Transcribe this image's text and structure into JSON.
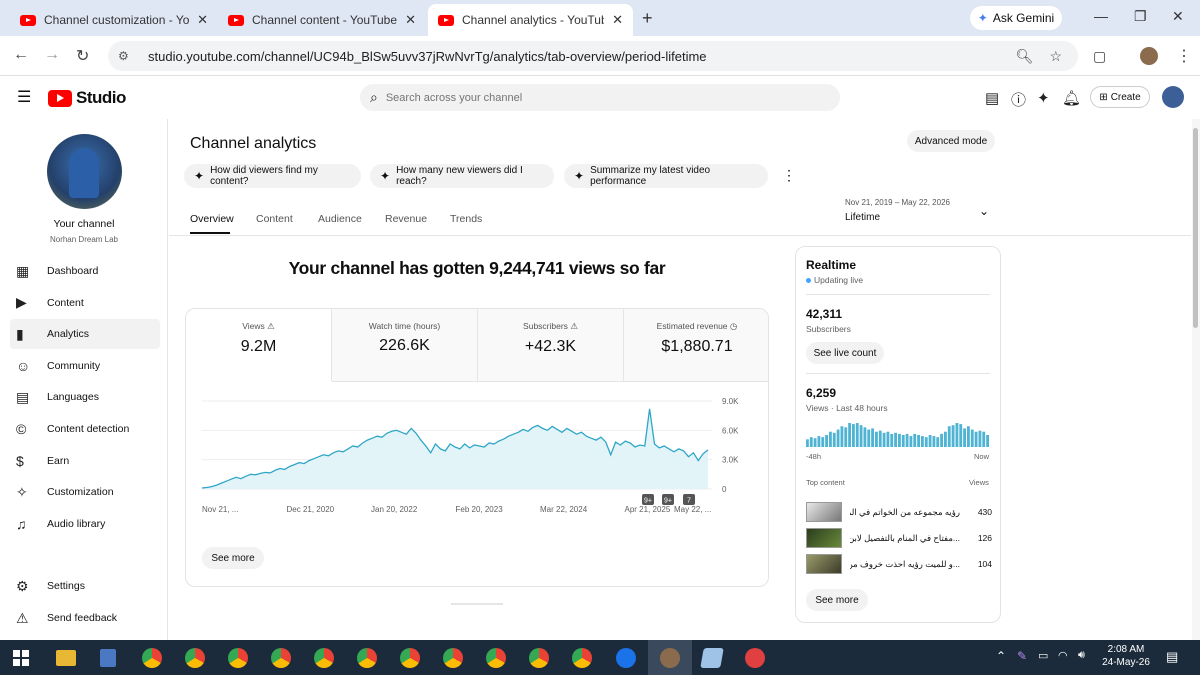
{
  "browser": {
    "tabs": [
      {
        "title": "Channel customization - YouTube Studio",
        "active": false
      },
      {
        "title": "Channel content - YouTube Studio",
        "active": false
      },
      {
        "title": "Channel analytics - YouTube Studio",
        "active": true
      }
    ],
    "ask_gemini": "Ask Gemini",
    "url": "studio.youtube.com/channel/UC94b_BlSw5uvv37jRwNvrTg/analytics/tab-overview/period-lifetime"
  },
  "studio": {
    "logo": "Studio",
    "search_placeholder": "Search across your channel",
    "create": "Create"
  },
  "sidebar": {
    "your_channel": "Your channel",
    "channel_name": "Norhan Dream Lab",
    "items": [
      {
        "label": "Dashboard",
        "icon": "dashboard-icon"
      },
      {
        "label": "Content",
        "icon": "content-icon"
      },
      {
        "label": "Analytics",
        "icon": "analytics-icon",
        "active": true
      },
      {
        "label": "Community",
        "icon": "community-icon"
      },
      {
        "label": "Languages",
        "icon": "languages-icon"
      },
      {
        "label": "Content detection",
        "icon": "copyright-icon"
      },
      {
        "label": "Earn",
        "icon": "dollar-icon"
      },
      {
        "label": "Customization",
        "icon": "magic-wand-icon"
      },
      {
        "label": "Audio library",
        "icon": "audio-library-icon"
      }
    ],
    "settings": "Settings",
    "feedback": "Send feedback"
  },
  "analytics": {
    "title": "Channel analytics",
    "advanced_mode": "Advanced mode",
    "chips": [
      "How did viewers find my content?",
      "How many new viewers did I reach?",
      "Summarize my latest video performance"
    ],
    "tabs": [
      "Overview",
      "Content",
      "Audience",
      "Revenue",
      "Trends"
    ],
    "date_range": "Nov 21, 2019 – May 22, 2026",
    "period": "Lifetime",
    "headline": "Your channel has gotten 9,244,741 views so far",
    "metrics": [
      {
        "label": "Views",
        "value": "9.2M"
      },
      {
        "label": "Watch time (hours)",
        "value": "226.6K"
      },
      {
        "label": "Subscribers",
        "value": "+42.3K"
      },
      {
        "label": "Estimated revenue",
        "value": "$1,880.71"
      }
    ],
    "see_more": "See more",
    "markers": [
      "9+",
      "9+",
      "7"
    ]
  },
  "chart_data": {
    "type": "area",
    "x_ticks": [
      "Nov 21, ...",
      "Dec 21, 2020",
      "Jan 20, 2022",
      "Feb 20, 2023",
      "Mar 22, 2024",
      "Apr 21, 2025",
      "May 22, ..."
    ],
    "y_ticks": [
      "9.0K",
      "6.0K",
      "3.0K",
      "0"
    ],
    "ylim": [
      0,
      9000
    ],
    "color": "#2fa6c6",
    "fill": "#e3f4f9",
    "values": [
      100,
      150,
      250,
      400,
      600,
      800,
      1000,
      1200,
      1050,
      1300,
      1500,
      1450,
      1600,
      1700,
      1650,
      1900,
      2100,
      2000,
      2300,
      2500,
      2700,
      2600,
      2900,
      3100,
      3300,
      3500,
      3400,
      3700,
      3900,
      3800,
      4100,
      4400,
      4300,
      4700,
      5000,
      5200,
      5400,
      5300,
      5700,
      5900,
      6000,
      5800,
      5600,
      6200,
      5700,
      5000,
      4400,
      3700,
      4600,
      4100,
      3900,
      4600,
      4300,
      4100,
      4600,
      4200,
      4500,
      4400,
      4300,
      4700,
      4600,
      4900,
      5100,
      5400,
      5600,
      5800,
      6100,
      5900,
      6300,
      6500,
      6200,
      6000,
      6400,
      6100,
      5800,
      6200,
      5900,
      5600,
      5800,
      5400,
      5200,
      5000,
      5300,
      4800,
      3500,
      4800,
      4500,
      4900,
      4700,
      4300,
      4500,
      4400,
      8200,
      4600,
      4200,
      4400,
      4100,
      3800,
      4100,
      3900,
      3300,
      3700,
      2900,
      3600,
      4000
    ]
  },
  "realtime": {
    "title": "Realtime",
    "updating": "Updating live",
    "subscribers_value": "42,311",
    "subscribers_label": "Subscribers",
    "see_live_count": "See live count",
    "views_value": "6,259",
    "views_label": "Views · Last 48 hours",
    "left_label": "-48h",
    "right_label": "Now",
    "top_content": "Top content",
    "views_col": "Views",
    "bars": [
      7,
      9,
      8,
      10,
      9,
      11,
      14,
      13,
      16,
      19,
      18,
      22,
      21,
      22,
      20,
      18,
      16,
      17,
      14,
      15,
      13,
      14,
      12,
      13,
      12,
      11,
      12,
      10,
      12,
      11,
      10,
      9,
      11,
      10,
      9,
      12,
      14,
      19,
      20,
      22,
      21,
      17,
      19,
      16,
      14,
      15,
      14,
      11
    ],
    "items": [
      {
        "title": "رؤيه مجموعه من الخواتم في المنام",
        "views": "430"
      },
      {
        "title": "...مفتاح في المنام بالتفصيل لابن سيرين",
        "views": "126"
      },
      {
        "title": "...و للميت رؤيه احذت خروف من الميت",
        "views": "104"
      }
    ],
    "see_more": "See more"
  },
  "taskbar": {
    "time": "2:08 AM",
    "date": "24-May-26"
  }
}
